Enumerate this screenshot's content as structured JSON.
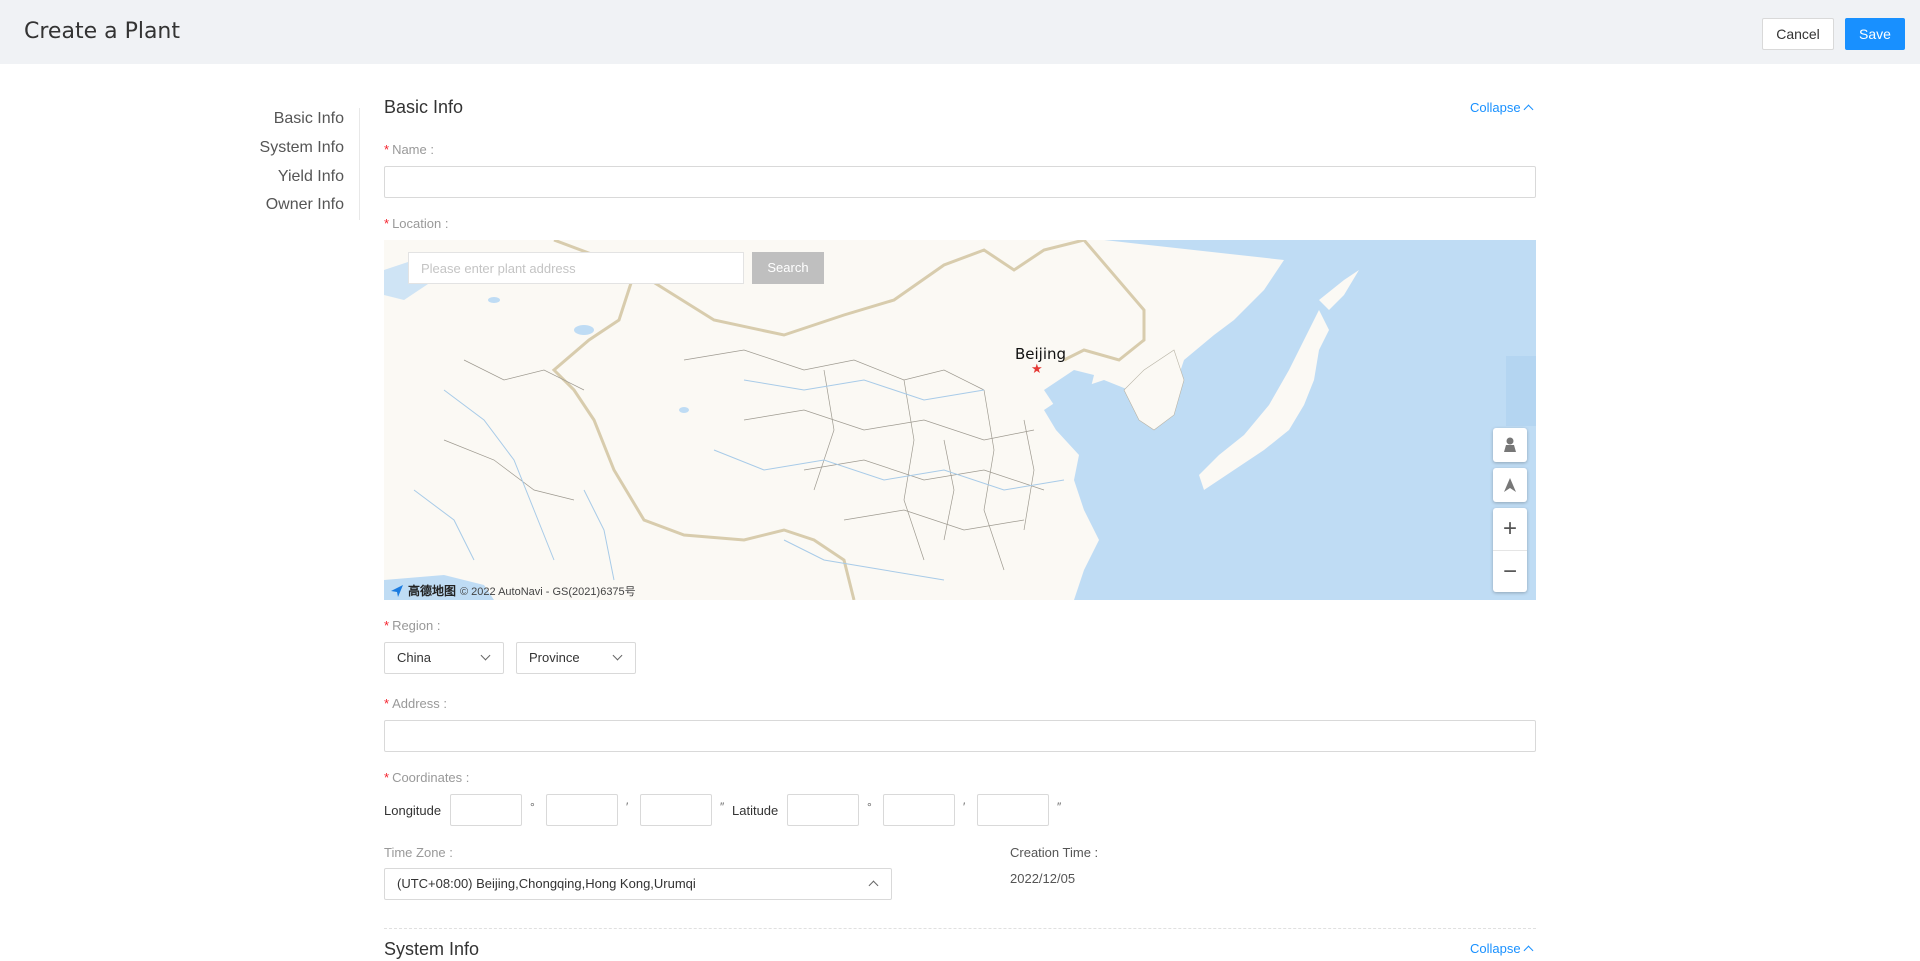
{
  "header": {
    "title": "Create a Plant",
    "cancel_label": "Cancel",
    "save_label": "Save"
  },
  "anchor_nav": [
    "Basic Info",
    "System Info",
    "Yield Info",
    "Owner Info"
  ],
  "basic_info": {
    "title": "Basic Info",
    "collapse_label": "Collapse",
    "name_label": "Name :",
    "location_label": "Location :",
    "region_label": "Region :",
    "address_label": "Address :",
    "coordinates_label": "Coordinates :",
    "timezone_label": "Time Zone :",
    "creation_time_label": "Creation Time :",
    "creation_time_value": "2022/12/05"
  },
  "map": {
    "search_placeholder": "Please enter plant address",
    "search_label": "Search",
    "city_label": "Beijing",
    "logo_text": "高德地图",
    "attribution": "© 2022 AutoNavi - GS(2021)6375号"
  },
  "region": {
    "country": "China",
    "province": "Province"
  },
  "coordinates": {
    "longitude_label": "Longitude",
    "latitude_label": "Latitude",
    "degree": "°",
    "minute": "′",
    "second": "″"
  },
  "timezone": {
    "value": "(UTC+08:00) Beijing,Chongqing,Hong Kong,Urumqi"
  },
  "system_info": {
    "title": "System Info",
    "collapse_label": "Collapse"
  }
}
